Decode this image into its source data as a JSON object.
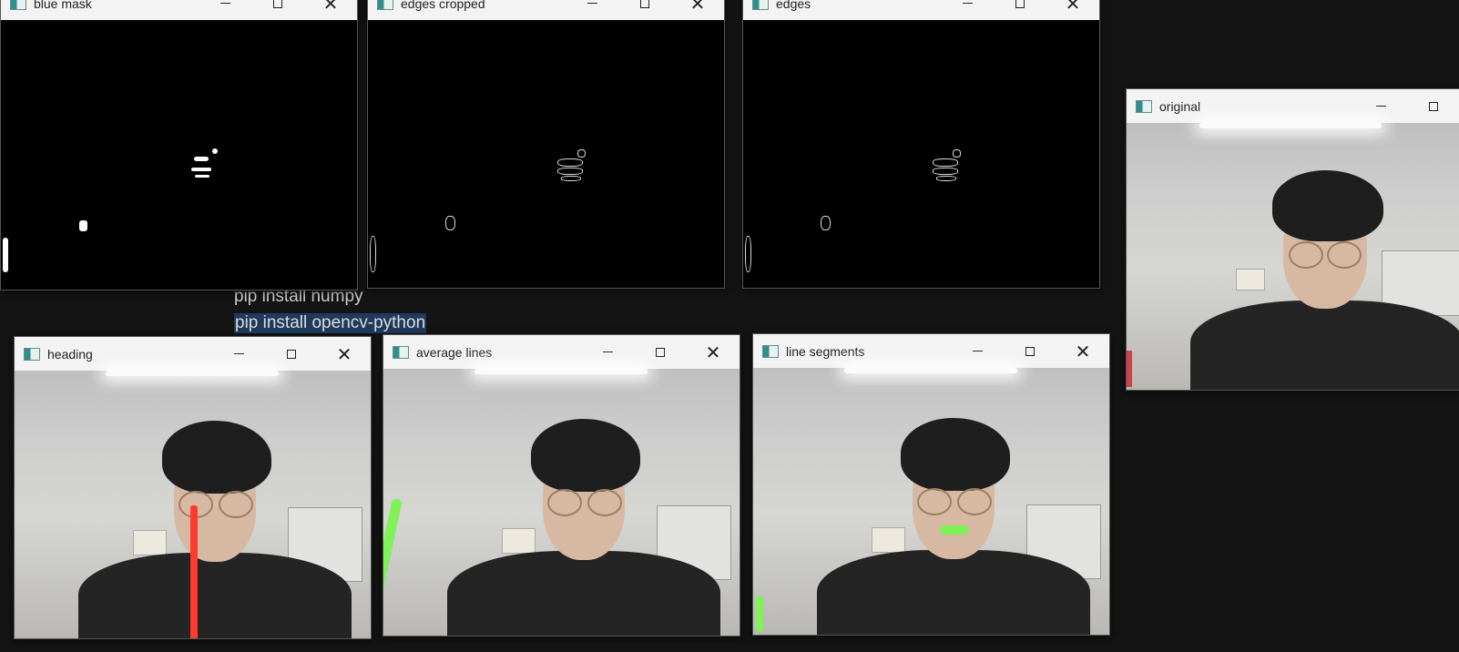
{
  "background_document": {
    "lines": [
      "pip install numpy",
      "pip install opencv-python"
    ],
    "selected_line_index": 1,
    "colors": {
      "bg": "#141414",
      "text": "#cfcfcf",
      "selection": "#1f3a5c"
    }
  },
  "windows": [
    {
      "id": "blue-mask",
      "title": "blue mask",
      "kind": "mask"
    },
    {
      "id": "edges-cropped",
      "title": "edges cropped",
      "kind": "edges"
    },
    {
      "id": "edges",
      "title": "edges",
      "kind": "edges"
    },
    {
      "id": "original",
      "title": "original",
      "kind": "camera"
    },
    {
      "id": "heading",
      "title": "heading",
      "kind": "camera",
      "overlay": "red vertical line"
    },
    {
      "id": "average-lines",
      "title": "average lines",
      "kind": "camera",
      "overlay": "green line left"
    },
    {
      "id": "line-segments",
      "title": "line segments",
      "kind": "camera",
      "overlay": "green segment at mouth"
    }
  ],
  "window_controls": {
    "minimize": "minimize-icon",
    "maximize": "maximize-icon",
    "close": "close-icon"
  },
  "colors": {
    "titlebar": "#f3f3f3",
    "heading_line": "#ff3a2e",
    "lane_line": "#7ef257"
  }
}
